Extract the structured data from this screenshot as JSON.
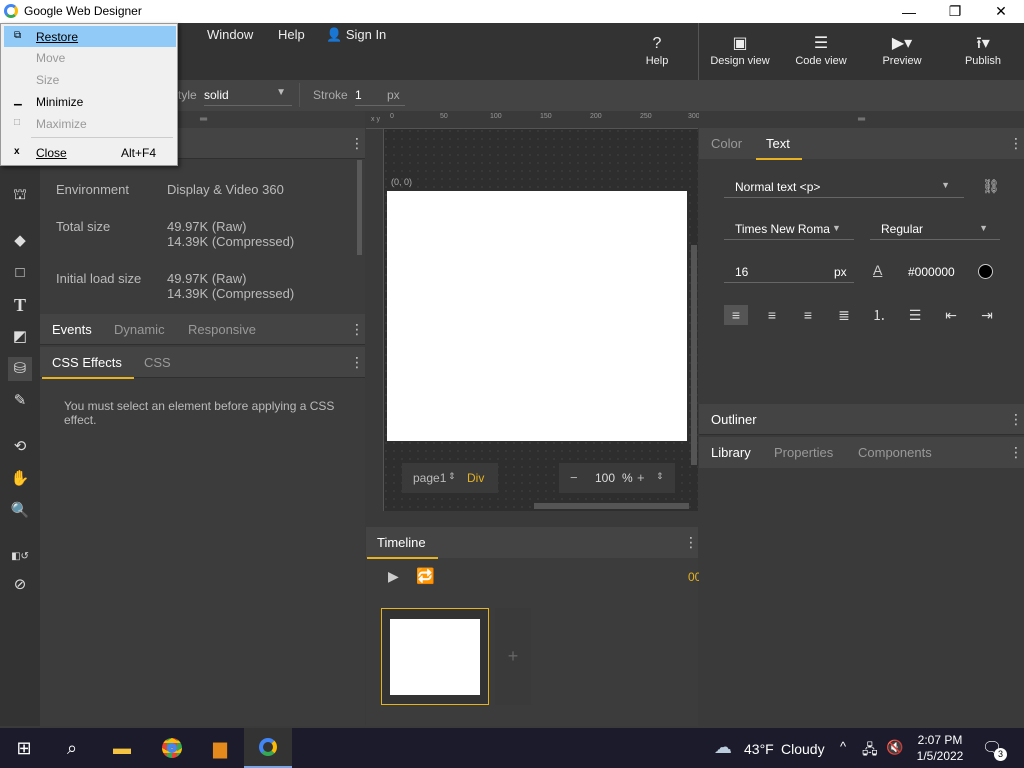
{
  "window": {
    "title": "Google Web Designer",
    "min": "—",
    "max": "❐",
    "close": "✕"
  },
  "menu": {
    "window": "Window",
    "help": "Help",
    "signin": "Sign In"
  },
  "toolbar": {
    "help": "Help",
    "design_view": "Design view",
    "code_view": "Code view",
    "preview": "Preview",
    "publish": "Publish"
  },
  "options": {
    "style_label": "tyle",
    "style_value": "solid",
    "stroke_label": "Stroke",
    "stroke_value": "1",
    "stroke_unit": "px"
  },
  "context_menu": {
    "restore": "Restore",
    "move": "Move",
    "size": "Size",
    "minimize": "Minimize",
    "maximize": "Maximize",
    "close": "Close",
    "close_shortcut": "Alt+F4"
  },
  "doc_props": {
    "environment_label": "Environment",
    "environment_value": "Display & Video 360",
    "total_label": "Total size",
    "total_raw": "49.97K (Raw)",
    "total_comp": "14.39K (Compressed)",
    "initial_label": "Initial load size",
    "initial_raw": "49.97K (Raw)",
    "initial_comp": "14.39K (Compressed)"
  },
  "events_tabs": {
    "events": "Events",
    "dynamic": "Dynamic",
    "responsive": "Responsive"
  },
  "css_tabs": {
    "effects": "CSS Effects",
    "css": "CSS"
  },
  "css_message": "You must select an element before applying a CSS effect.",
  "stage": {
    "origin": "(0, 0)",
    "page": "page1",
    "element": "Div",
    "zoom": "100",
    "zoom_unit": "%",
    "ruler_ticks": [
      "0",
      "50",
      "100",
      "150",
      "200",
      "250",
      "300"
    ],
    "ruler_xy": "x y"
  },
  "timeline": {
    "label": "Timeline",
    "time": "00"
  },
  "right_tabs": {
    "color": "Color",
    "text": "Text"
  },
  "text_props": {
    "style": "Normal text <p>",
    "font": "Times New Roma",
    "weight": "Regular",
    "size": "16",
    "size_unit": "px",
    "color": "#000000"
  },
  "outliner": "Outliner",
  "library_tabs": {
    "library": "Library",
    "properties": "Properties",
    "components": "Components"
  },
  "taskbar": {
    "temp": "43°F",
    "weather": "Cloudy",
    "time": "2:07 PM",
    "date": "1/5/2022",
    "notif_count": "3"
  }
}
